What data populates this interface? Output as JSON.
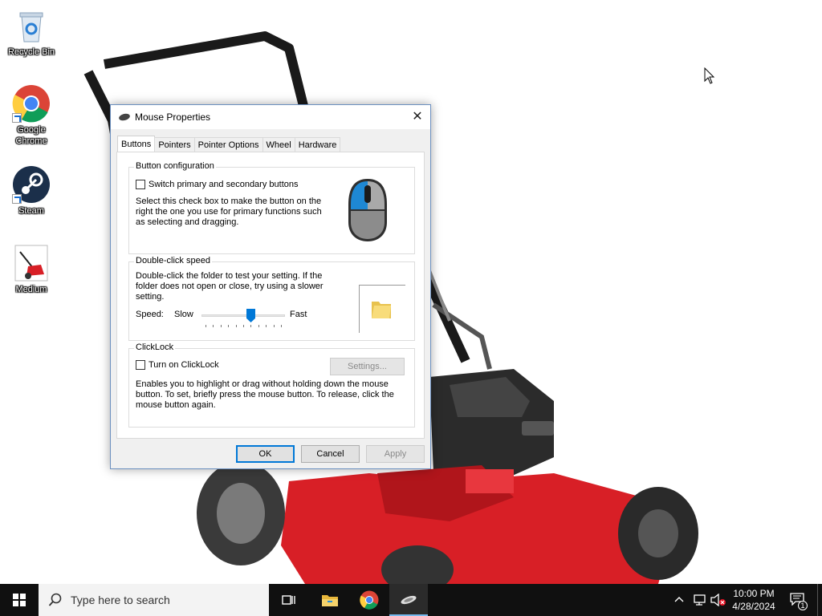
{
  "desktop": {
    "icons": [
      {
        "label": "Recycle Bin",
        "icon": "recycle-bin-icon"
      },
      {
        "label": "Google Chrome",
        "icon": "chrome-icon"
      },
      {
        "label": "Steam",
        "icon": "steam-icon"
      },
      {
        "label": "Medium",
        "icon": "image-file-icon"
      }
    ]
  },
  "dialog": {
    "title": "Mouse Properties",
    "close_glyph": "✕",
    "tabs": [
      {
        "label": "Buttons",
        "active": true
      },
      {
        "label": "Pointers"
      },
      {
        "label": "Pointer Options"
      },
      {
        "label": "Wheel"
      },
      {
        "label": "Hardware"
      }
    ],
    "button_config": {
      "legend": "Button configuration",
      "checkbox_label": "Switch primary and secondary buttons",
      "checked": false,
      "description": "Select this check box to make the button on the right the one you use for primary functions such as selecting and dragging."
    },
    "double_click": {
      "legend": "Double-click speed",
      "description": "Double-click the folder to test your setting.  If the folder does not open or close, try using a slower setting.",
      "speed_label": "Speed:",
      "slow_label": "Slow",
      "fast_label": "Fast",
      "slider_value": 0.6
    },
    "clicklock": {
      "legend": "ClickLock",
      "checkbox_label": "Turn on ClickLock",
      "checked": false,
      "settings_label": "Settings...",
      "description": "Enables you to highlight or drag without holding down the mouse button.  To set, briefly press the mouse button.  To release, click the mouse button again."
    },
    "buttons": {
      "ok": "OK",
      "cancel": "Cancel",
      "apply": "Apply"
    }
  },
  "taskbar": {
    "search_placeholder": "Type here to search",
    "time": "10:00 PM",
    "date": "4/28/2024",
    "notification_count": "1"
  },
  "colors": {
    "accent": "#0078d7",
    "taskbar": "#101010",
    "mower_red": "#d81f26"
  }
}
